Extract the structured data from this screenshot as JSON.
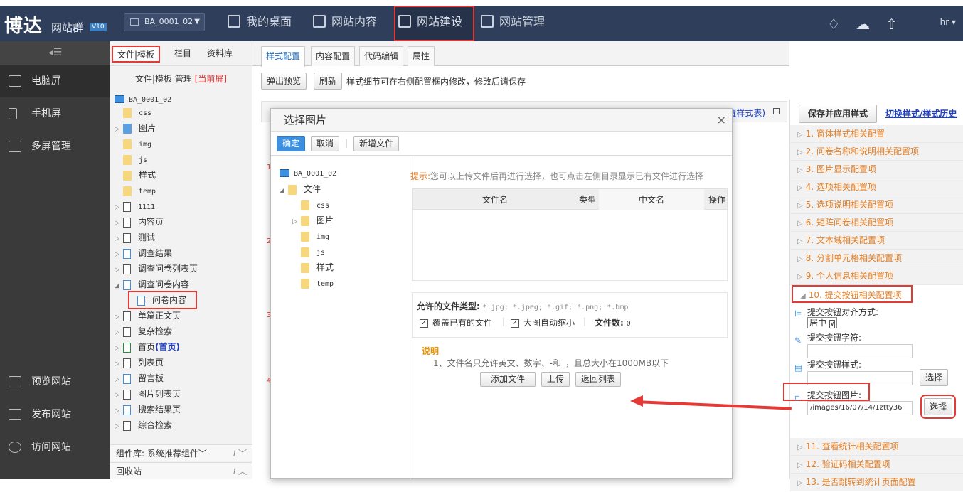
{
  "topbar": {
    "logo": "博达",
    "logo_sub": "网站群",
    "version": "V10",
    "site_select": "BA_0001_02",
    "nav": [
      "我的桌面",
      "网站内容",
      "网站建设",
      "网站管理"
    ],
    "user": "hr"
  },
  "leftnav": {
    "items": [
      "电脑屏",
      "手机屏",
      "多屏管理"
    ],
    "bottom": [
      "预览网站",
      "发布网站",
      "访问网站"
    ]
  },
  "tree": {
    "tabs": [
      "文件|模板",
      "栏目",
      "资料库"
    ],
    "head_label": "文件|模板 管理",
    "head_tag": "[当前屏]",
    "root": "BA_0001_02",
    "items": [
      "css",
      "图片",
      "img",
      "js",
      "样式",
      "temp",
      "1111",
      "内容页",
      "测试",
      "调查结果",
      "调查问卷列表页",
      "调查问卷内容",
      "问卷内容",
      "单篇正文页",
      "复杂检索",
      "首页",
      "(首页)",
      "列表页",
      "留言板",
      "图片列表页",
      "搜索结果页",
      "综合检索"
    ],
    "component_bar": "组件库: 系统推荐组件",
    "recycle": "回收站",
    "bar_icon": "i"
  },
  "main": {
    "tabs": [
      "样式配置",
      "内容配置",
      "代码编辑",
      "属性"
    ],
    "toolbar": {
      "preview": "弹出预览",
      "refresh": "刷新",
      "hint": "样式细节可在右侧配置框内修改，修改后请保存"
    },
    "behind_link": "置样式表)",
    "row_numbers": [
      "1",
      "2",
      "3",
      "4"
    ]
  },
  "right_panel": {
    "save_button": "保存并应用样式",
    "history_link": "切换样式/样式历史",
    "sections": [
      "1. 窗体样式相关配置",
      "2. 问卷名称和说明相关配置项",
      "3. 图片显示配置项",
      "4. 选项相关配置项",
      "5. 选项说明相关配置项",
      "6. 矩阵问卷相关配置项",
      "7. 文本域相关配置项",
      "8. 分割单元格相关配置项",
      "9. 个人信息相关配置项",
      "10. 提交按钮相关配置项"
    ],
    "after_sections": [
      "11. 查看统计相关配置项",
      "12. 验证码相关配置项",
      "13. 是否跳转到统计页面配置"
    ],
    "fields": {
      "align_label": "提交按钮对齐方式:",
      "align_value": "居中",
      "text_label": "提交按钮字符:",
      "style_label": "提交按钮样式:",
      "image_label": "提交按钮图片:",
      "image_value": "/images/16/07/14/1ztty36",
      "select_label": "选择"
    }
  },
  "modal": {
    "title": "选择图片",
    "close": "×",
    "buttons": {
      "ok": "确定",
      "cancel": "取消",
      "new_file": "新增文件"
    },
    "tree_root": "BA_0001_02",
    "tree_folder": "文件",
    "tree_children": [
      "css",
      "图片",
      "img",
      "js",
      "样式",
      "temp"
    ],
    "hint_label": "提示:",
    "hint_text": "您可以上传文件后再进行选择，也可点击左侧目录显示已有文件进行选择",
    "columns": [
      "文件名",
      "类型",
      "中文名",
      "操作"
    ],
    "allowed_label": "允许的文件类型:",
    "allowed_types": "*.jpg; *.jpeg; *.gif; *.png; *.bmp",
    "overwrite": "覆盖已有的文件",
    "autoshrink": "大图自动缩小",
    "file_count_label": "文件数:",
    "file_count": "0",
    "note_title": "说明",
    "note_text": "1、文件名只允许英文、数字、-和_，且总大小在1000MB以下",
    "actions": [
      "添加文件",
      "上传",
      "返回列表"
    ]
  },
  "colors": {
    "topbar": "#2f3e5a",
    "highlight": "#e53935",
    "accent": "#3d8fdf",
    "orange": "#e67e22"
  }
}
